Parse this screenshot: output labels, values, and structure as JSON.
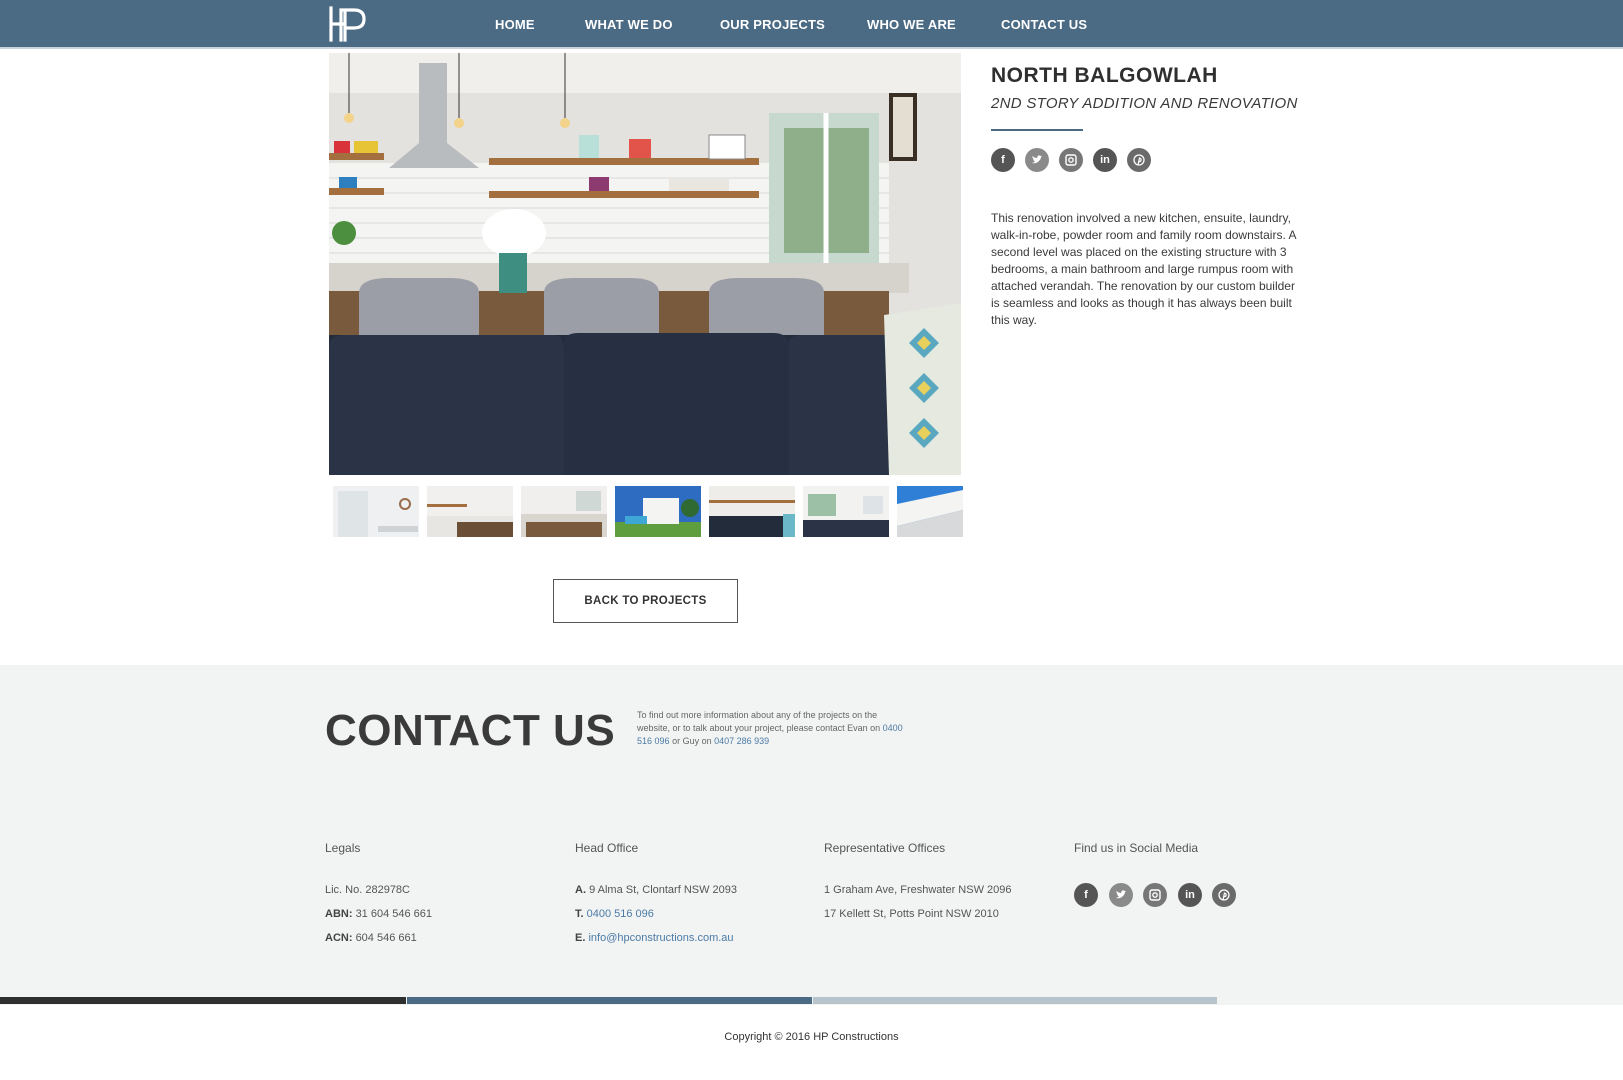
{
  "colors": {
    "header_bg": "#4b6a84",
    "footer_bg": "#f2f3f3",
    "link": "#4b7ba6",
    "bar_dark": "#2f2f2f",
    "bar_mid": "#4b6a84",
    "bar_light": "#b8c4cc"
  },
  "logo": {
    "icon": "hp-logo-icon"
  },
  "nav": {
    "items": [
      {
        "label": "HOME"
      },
      {
        "label": "WHAT WE DO"
      },
      {
        "label": "OUR PROJECTS"
      },
      {
        "label": "WHO WE ARE"
      },
      {
        "label": "CONTACT US"
      }
    ]
  },
  "project": {
    "title": "NORTH BALGOWLAH",
    "subtitle": "2ND STORY ADDITION AND RENOVATION",
    "description": "This renovation involved a new kitchen, ensuite, laundry, walk-in-robe, powder room and family room downstairs. A second level was placed on the existing structure with 3 bedrooms, a main bathroom and large rumpus room with attached verandah. The renovation by our custom builder is seamless and looks as though it has always been built this way.",
    "social_icons": [
      "facebook-icon",
      "twitter-icon",
      "instagram-icon",
      "linkedin-icon",
      "pinterest-icon"
    ],
    "thumbnail_count": 7
  },
  "back_button": {
    "label": "BACK TO PROJECTS"
  },
  "contact": {
    "title": "CONTACT US",
    "text_before": "To find out more information about any of the projects on the website, or to talk about your project, please contact Evan on",
    "phone_evan": "0400 516 096",
    "text_mid": "or Guy on",
    "phone_guy": "0407 286 939"
  },
  "footer": {
    "legals": {
      "heading": "Legals",
      "lic": "Lic. No. 282978C",
      "abn_label": "ABN:",
      "abn": "31 604 546 661",
      "acn_label": "ACN:",
      "acn": "604 546 661"
    },
    "head_office": {
      "heading": "Head Office",
      "address_label": "A.",
      "address": "9 Alma St, Clontarf NSW 2093",
      "phone_label": "T.",
      "phone": "0400 516 096",
      "email_label": "E.",
      "email": "info@hpconstructions.com.au"
    },
    "rep_offices": {
      "heading": "Representative Offices",
      "line1": "1 Graham Ave, Freshwater NSW 2096",
      "line2": "17 Kellett St, Potts Point NSW 2010"
    },
    "social": {
      "heading": "Find us in Social Media",
      "icons": [
        "facebook-icon",
        "twitter-icon",
        "instagram-icon",
        "linkedin-icon",
        "pinterest-icon"
      ]
    },
    "copyright": "Copyright © 2016 HP Constructions"
  }
}
